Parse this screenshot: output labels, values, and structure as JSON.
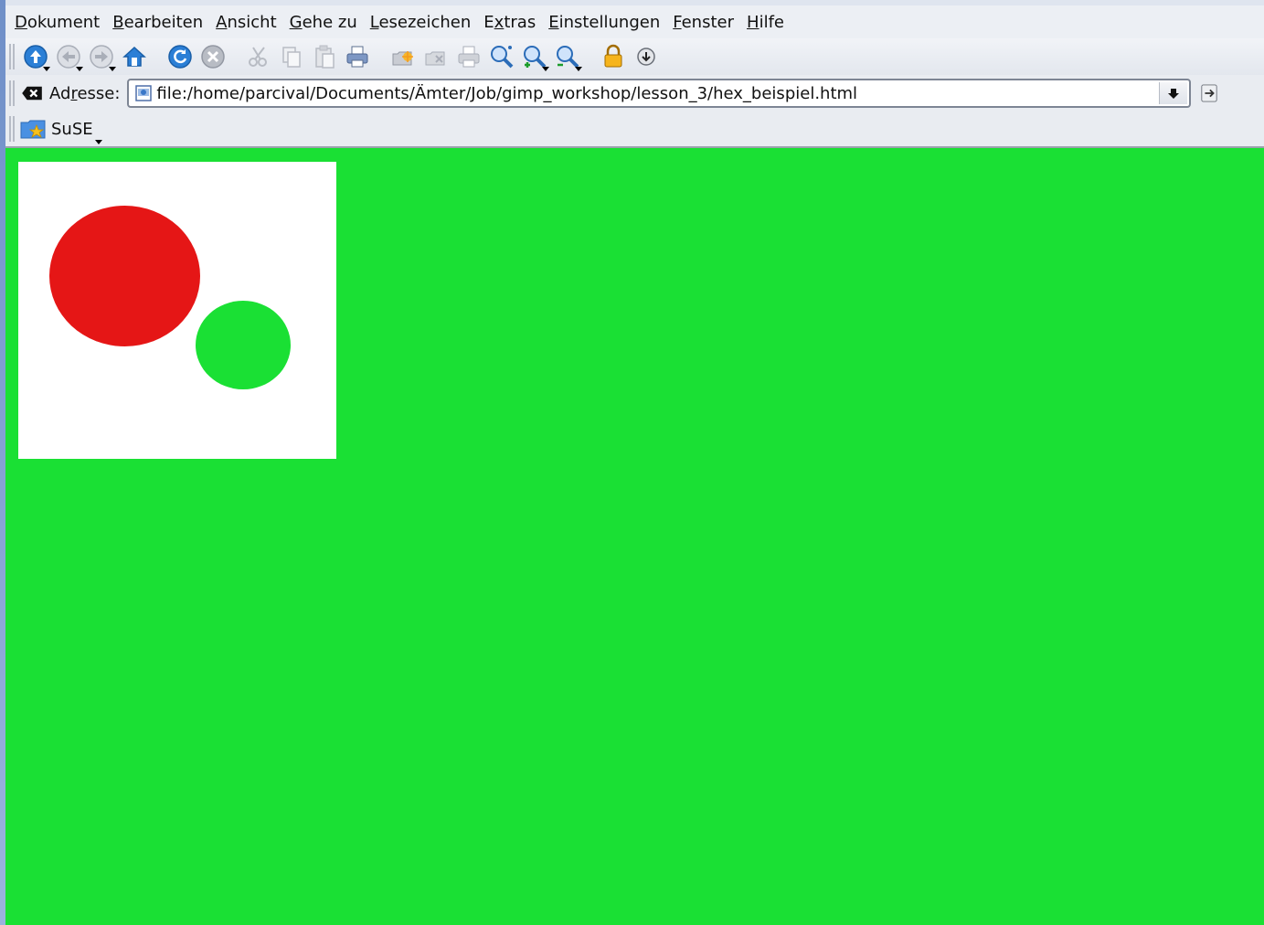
{
  "menubar": {
    "items": [
      {
        "pre": "",
        "ul": "D",
        "post": "okument"
      },
      {
        "pre": "",
        "ul": "B",
        "post": "earbeiten"
      },
      {
        "pre": "",
        "ul": "A",
        "post": "nsicht"
      },
      {
        "pre": "",
        "ul": "G",
        "post": "ehe zu"
      },
      {
        "pre": "",
        "ul": "L",
        "post": "esezeichen"
      },
      {
        "pre": "E",
        "ul": "x",
        "post": "tras"
      },
      {
        "pre": "",
        "ul": "E",
        "post": "instellungen"
      },
      {
        "pre": "",
        "ul": "F",
        "post": "enster"
      },
      {
        "pre": "",
        "ul": "H",
        "post": "ilfe"
      }
    ]
  },
  "location": {
    "label_pre": "Ad",
    "label_ul": "r",
    "label_post": "esse:",
    "url": "file:/home/parcival/Documents/Ämter/Job/gimp_workshop/lesson_3/hex_beispiel.html"
  },
  "bookmarks": {
    "items": [
      {
        "label": "SuSE"
      }
    ]
  },
  "icons": [
    "up-arrow-icon",
    "back-icon",
    "forward-icon",
    "home-icon",
    "reload-icon",
    "stop-icon",
    "cut-icon",
    "copy-icon",
    "paste-icon",
    "print-icon",
    "new-tab-icon",
    "close-tab-icon",
    "print-frame-icon",
    "zoom-icon",
    "zoom-in-icon",
    "zoom-out-icon",
    "lock-icon",
    "download-icon"
  ],
  "colors": {
    "page_background": "#1ae034",
    "image_background": "#ffffff",
    "red_circle": "#e51616",
    "green_circle": "#1ae034",
    "icon_blue": "#2b7fd6",
    "icon_gray": "#b8bcc4"
  }
}
